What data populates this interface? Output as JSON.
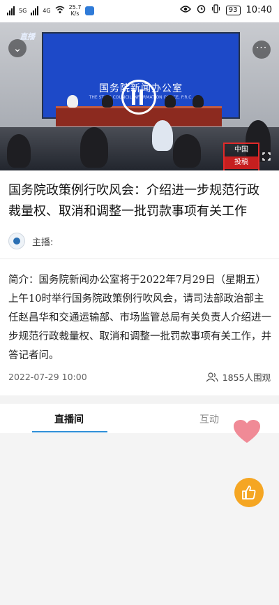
{
  "status_bar": {
    "network_speed": "25.7",
    "network_unit": "K/s",
    "signal_labels": [
      "5G",
      "4G"
    ],
    "battery_level": "93",
    "time": "10:40"
  },
  "video": {
    "screen_title": "国务院新闻办公室",
    "screen_subtitle": "THE STATE COUNCIL INFORMATION OFFICE, P.R.C.",
    "channel_logo": "直播",
    "badge_top": "中国",
    "badge_bottom": "投稿"
  },
  "article": {
    "title": "国务院政策例行吹风会：介绍进一步规范行政裁量权、取消和调整一批罚款事项有关工作",
    "host_label": "主播:",
    "intro": "简介：国务院新闻办公室将于2022年7月29日（星期五）上午10时举行国务院政策例行吹风会，请司法部政治部主任赵昌华和交通运输部、市场监管总局有关负责人介绍进一步规范行政裁量权、取消和调整一批罚款事项有关工作，并答记者问。",
    "date": "2022-07-29 10:00",
    "viewers": "1855人围观"
  },
  "tabs": [
    {
      "label": "直播间",
      "active": true
    },
    {
      "label": "互动",
      "active": false
    }
  ],
  "colors": {
    "accent": "#2e8fd8",
    "like_button": "#f5a623",
    "heart": "#f08a96"
  },
  "icons": {
    "collapse": "chevron-down-icon",
    "more": "more-icon",
    "fullscreen": "fullscreen-icon",
    "viewers": "people-icon",
    "like": "thumbs-up-icon",
    "heart": "heart-icon"
  }
}
